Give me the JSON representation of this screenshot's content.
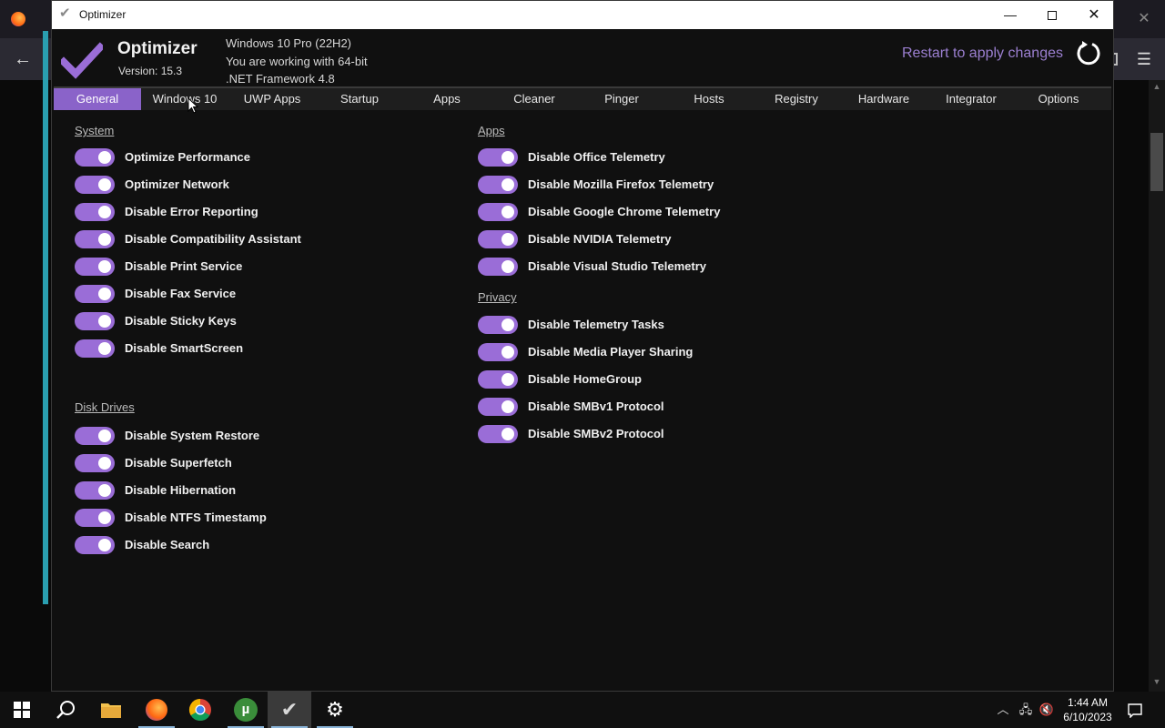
{
  "window": {
    "title": "Optimizer",
    "minimize": "—",
    "close": "✕"
  },
  "header": {
    "app_name": "Optimizer",
    "version": "Version: 15.3",
    "os": "Windows 10 Pro (22H2)",
    "arch": "You are working with 64-bit",
    "framework": ".NET Framework 4.8",
    "restart": "Restart to apply changes"
  },
  "tabs": [
    "General",
    "Windows 10",
    "UWP Apps",
    "Startup",
    "Apps",
    "Cleaner",
    "Pinger",
    "Hosts",
    "Registry",
    "Hardware",
    "Integrator",
    "Options"
  ],
  "active_tab": "General",
  "system": {
    "title": "System",
    "items": [
      "Optimize Performance",
      "Optimizer Network",
      "Disable Error Reporting",
      "Disable Compatibility Assistant",
      "Disable Print Service",
      "Disable Fax Service",
      "Disable Sticky Keys",
      "Disable SmartScreen"
    ]
  },
  "disk": {
    "title": "Disk Drives",
    "items": [
      "Disable System Restore",
      "Disable Superfetch",
      "Disable Hibernation",
      "Disable NTFS Timestamp",
      "Disable Search"
    ]
  },
  "apps": {
    "title": "Apps",
    "items": [
      "Disable Office Telemetry",
      "Disable Mozilla Firefox Telemetry",
      "Disable Google Chrome Telemetry",
      "Disable NVIDIA Telemetry",
      "Disable Visual Studio Telemetry"
    ]
  },
  "privacy": {
    "title": "Privacy",
    "items": [
      "Disable Telemetry Tasks",
      "Disable Media Player Sharing",
      "Disable HomeGroup",
      "Disable SMBv1 Protocol",
      "Disable SMBv2 Protocol"
    ]
  },
  "taskbar": {
    "time": "1:44 AM",
    "date": "6/10/2023"
  },
  "colors": {
    "accent": "#8a63c9",
    "toggle_on": "#9a6dd7",
    "restart_text": "#9b7fd0"
  }
}
